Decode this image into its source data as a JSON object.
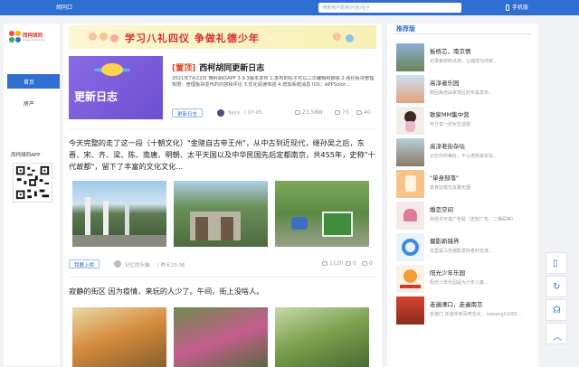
{
  "topbar": {
    "location_label": "胡同口",
    "search_placeholder": "搜索用户昵称/内容/帖子",
    "mobile_label": "手机版"
  },
  "left_nav": {
    "logo_text": "西柯胡同",
    "logo_sub": "www.xikehutong",
    "items": [
      {
        "label": "首页",
        "active": true
      },
      {
        "label": "房产",
        "active": false
      }
    ],
    "app_label": "西柯胡同APP"
  },
  "banner": {
    "text": "学习八礼四仪 争做礼德少年"
  },
  "pinned_post": {
    "thumb_text": "更新日志",
    "tag": "[置顶]",
    "title": "西柯胡同更新日志",
    "desc": "2021年7月22日 西柯胡同APP 3.9.3版本发布 1.发布的帖子可以二次编辑和删除 2.强化板块管理权限：管理板块发布的内容和评论 3.优化阅读体验 4.增加系统消息 IOS：APPSolor...",
    "category": "更新日志",
    "author": "Syyy",
    "date": "07-05",
    "views": "23.58W",
    "comments": "75",
    "likes": "40"
  },
  "post1": {
    "text": "今天完整的走了这一段（十朝文化）\"金陵自古帝王州\"，从中古到近现代，继孙吴之后，东晋、宋、齐、梁、陈、南唐、明朝、太平天国以及中华民国先后定都南京，共455年，史称\"十代故都\"，留下了丰富的文化文化...",
    "category": "我要上榜",
    "author": "记忆的头脑",
    "date": "昨天23:36",
    "views": "1120",
    "comments": "0",
    "likes": "0"
  },
  "post2": {
    "text": "寂静的街区 因为疫情，来玩的人少了。午间，街上没啥人。"
  },
  "sidebar": {
    "title": "推荐版",
    "items": [
      {
        "name": "板桥芯，南京情",
        "desc": "记录板桥的点滴，让城成为你家..."
      },
      {
        "name": "高淳者乐园",
        "desc": "想回来自由家地区的专属发布..."
      },
      {
        "name": "致家MM集中营",
        "desc": "可分享一切女生话题"
      },
      {
        "name": "高淳老街杂坛",
        "desc": "记忆中的美好，不以老街家杂坛..."
      },
      {
        "name": "\"单身部落\"",
        "desc": "单身征婚交友聊天圈"
      },
      {
        "name": "婚恋空间",
        "desc": "未经许可发广告贴（含软广告，二维码等）"
      },
      {
        "name": "摄影新镜界",
        "desc": "这里是江苏摄影爱好者的交流..."
      },
      {
        "name": "阳光少年乐园",
        "desc": "阳光少年乐园是为少年儿童..."
      },
      {
        "name": "走遍溧口，走遍南京",
        "desc": "走遍口 走遍中老百吧宝太... szwangli1001..."
      }
    ]
  },
  "colors": {
    "primary": "#2f6fd2",
    "accent_red": "#e0482a"
  }
}
